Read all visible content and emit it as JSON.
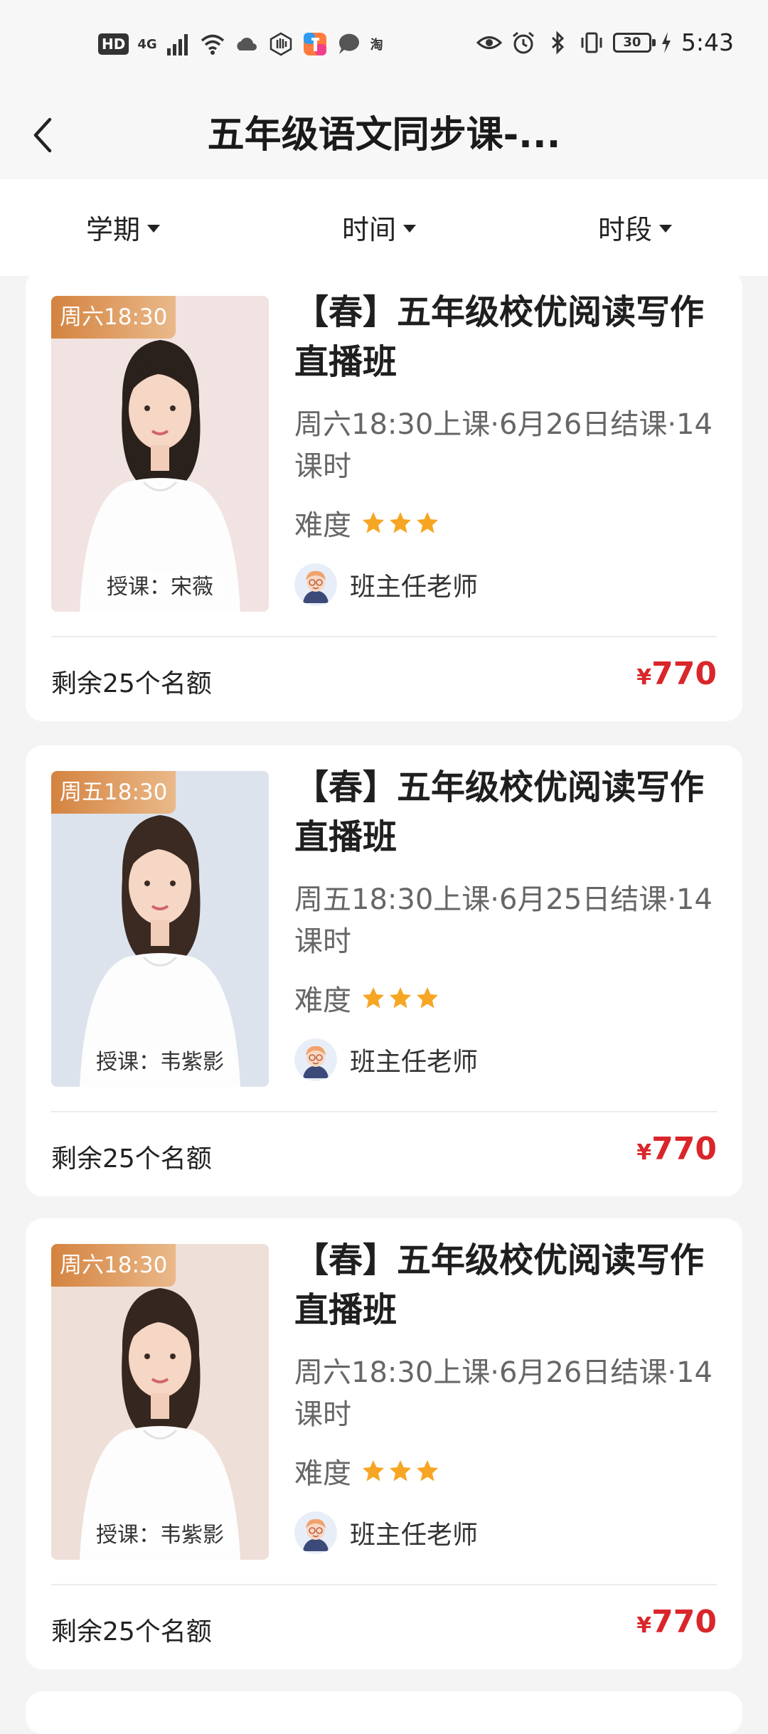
{
  "status_bar": {
    "left_badge": "HD",
    "signal_label": "4G",
    "taobao_label": "淘",
    "battery": "30",
    "time": "5:43"
  },
  "header": {
    "title": "五年级语文同步课-..."
  },
  "filters": [
    {
      "label": "学期"
    },
    {
      "label": "时间"
    },
    {
      "label": "时段"
    }
  ],
  "courses": [
    {
      "time_tag": "周六18:30",
      "teacher": "授课：宋薇",
      "title": "【春】五年级校优阅读写作直播班",
      "schedule": "周六18:30上课·6月26日结课·14课时",
      "difficulty_label": "难度",
      "difficulty_stars": 3,
      "head_teacher": "班主任老师",
      "seats": "剩余25个名额",
      "currency": "¥",
      "price": "770",
      "photo_bg": "#f1e3e1"
    },
    {
      "time_tag": "周五18:30",
      "teacher": "授课：韦紫影",
      "title": "【春】五年级校优阅读写作直播班",
      "schedule": "周五18:30上课·6月25日结课·14课时",
      "difficulty_label": "难度",
      "difficulty_stars": 3,
      "head_teacher": "班主任老师",
      "seats": "剩余25个名额",
      "currency": "¥",
      "price": "770",
      "photo_bg": "#dce3ec"
    },
    {
      "time_tag": "周六18:30",
      "teacher": "授课：韦紫影",
      "title": "【春】五年级校优阅读写作直播班",
      "schedule": "周六18:30上课·6月26日结课·14课时",
      "difficulty_label": "难度",
      "difficulty_stars": 3,
      "head_teacher": "班主任老师",
      "seats": "剩余25个名额",
      "currency": "¥",
      "price": "770",
      "photo_bg": "#eedfd8"
    }
  ],
  "colors": {
    "price": "#d9262b",
    "star": "#f6a623",
    "tag_gradient_start": "#d4833f"
  }
}
